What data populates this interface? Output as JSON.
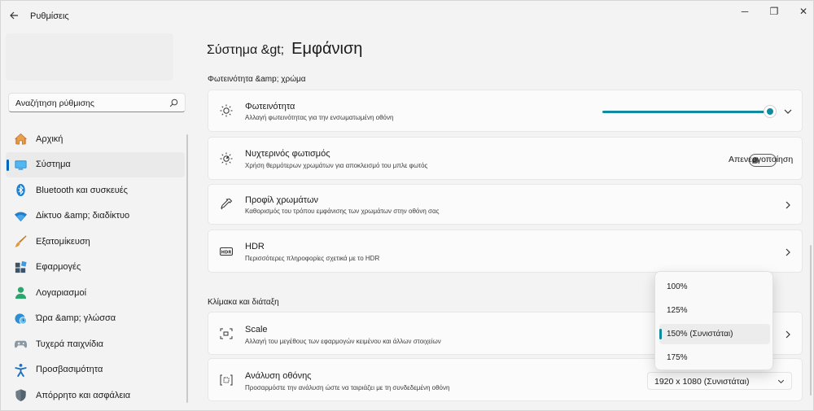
{
  "window": {
    "title": "Ρυθμίσεις",
    "controls": {
      "minimize": "─",
      "maximize": "❐",
      "close": "✕"
    }
  },
  "search": {
    "placeholder": "Αναζήτηση ρύθμισης",
    "value": ""
  },
  "sidebar": {
    "items": [
      {
        "label": "Αρχική",
        "icon": "home-icon",
        "active": false
      },
      {
        "label": "Σύστημα",
        "icon": "system-icon",
        "active": true
      },
      {
        "label": "Bluetooth και συσκευές",
        "icon": "bluetooth-icon",
        "active": false
      },
      {
        "label": "Δίκτυο &amp; διαδίκτυο",
        "icon": "wifi-icon",
        "active": false
      },
      {
        "label": "Εξατομίκευση",
        "icon": "brush-icon",
        "active": false
      },
      {
        "label": "Εφαρμογές",
        "icon": "apps-icon",
        "active": false
      },
      {
        "label": "Λογαριασμοί",
        "icon": "account-icon",
        "active": false
      },
      {
        "label": "Ώρα &amp; γλώσσα",
        "icon": "globe-clock-icon",
        "active": false
      },
      {
        "label": "Τυχερά παιχνίδια",
        "icon": "gamepad-icon",
        "active": false
      },
      {
        "label": "Προσβασιμότητα",
        "icon": "accessibility-icon",
        "active": false
      },
      {
        "label": "Απόρρητο και ασφάλεια",
        "icon": "shield-icon",
        "active": false
      }
    ]
  },
  "breadcrumb": {
    "parent": "Σύστημα &gt;",
    "current": "Εμφάνιση"
  },
  "sections": {
    "brightness_color": "Φωτεινότητα &amp; χρώμα",
    "scale_layout": "Κλίμακα και διάταξη"
  },
  "cards": {
    "brightness": {
      "title": "Φωτεινότητα",
      "subtitle": "Αλλαγή φωτεινότητας για την ενσωματωμένη οθόνη",
      "level_percent": 100
    },
    "night_light": {
      "title": "Νυχτερινός φωτισμός",
      "subtitle": "Χρήση θερμότερων χρωμάτων για αποκλεισμό του μπλε φωτός",
      "toggle_label": "Απενεργοποίηση",
      "on": false
    },
    "color_profile": {
      "title": "Προφίλ χρωμάτων",
      "subtitle": "Καθορισμός του τρόπου εμφάνισης των χρωμάτων στην οθόνη σας"
    },
    "hdr": {
      "title": "HDR",
      "subtitle": "Περισσότερες πληροφορίες σχετικά με το HDR"
    },
    "scale": {
      "title": "Scale",
      "subtitle": "Αλλαγή του μεγέθους των εφαρμογών κειμένου και άλλων στοιχείων"
    },
    "resolution": {
      "title": "Ανάλυση οθόνης",
      "subtitle": "Προσαρμόστε την ανάλυση ώστε να ταιριάζει με τη συνδεδεμένη οθόνη",
      "value": "1920 x 1080 (Συνιστάται)"
    }
  },
  "scale_dropdown": {
    "options": [
      "100%",
      "125%",
      "150% (Συνιστάται)",
      "175%"
    ],
    "selected": "150% (Συνιστάται)"
  },
  "colors": {
    "accent": "#0f8aa0",
    "nav_accent": "#0067c0"
  }
}
